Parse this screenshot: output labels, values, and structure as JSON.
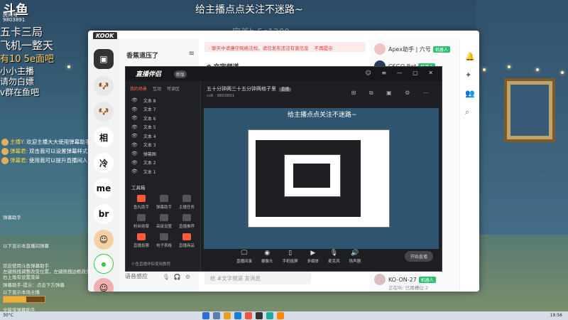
{
  "overlay": {
    "logo": "斗鱼",
    "room_label": "房间号",
    "room_number": "9803891",
    "top_banner": "给主播点点关注不迷路~",
    "sub_banner": "完美b  5e1200",
    "side_lines": [
      "五卡三局",
      "飞机一整天",
      "有10  5e面吧",
      "小小主播",
      "请勿白嫖",
      "v群在鱼吧"
    ],
    "chat": [
      {
        "name": "主播Y:",
        "text": "欢迎主播大大使用弹幕助手"
      },
      {
        "name": "弹幕君:",
        "text": "双击我可以设置弹幕样式"
      },
      {
        "name": "弹幕君:",
        "text": "使用我可以提升直播间人气"
      }
    ],
    "lower_lines": [
      "弹幕助手",
      "以下显示本直播间弹幕",
      "欢迎使用斗鱼弹幕助手",
      "左键拖拽调整改变位置，左键拖拽边框改变大小",
      "右上角有设置菜单",
      "弹幕助手-提示：点击下方弹幕",
      "以下显示本场主播",
      "全能宝弹幕助手"
    ],
    "bar_fraction": 0.55
  },
  "kook": {
    "title": "KOOK",
    "rail_items": [
      "相",
      "冷",
      "me",
      "br"
    ],
    "guild_name": "香蕉道压了",
    "notice": "· 聊天中请遵守网络法规，请勿发布违法有害信息",
    "notice_link": "不再提示",
    "channel_title": "# 文字频道",
    "voice_label": "语音感应",
    "input_placeholder": "给 #文字频道 发消息",
    "members": [
      {
        "name": "Apex助手 | 六号",
        "tag": "机器人",
        "sub": ""
      },
      {
        "name": "CSGO Bot",
        "tag": "机器人",
        "sub": ""
      },
      {
        "name": "KO-ON-27",
        "tag": "机器人",
        "sub": "正在听: 已用槽位:2"
      }
    ]
  },
  "streamer_app": {
    "title": "直播伴侣",
    "version": "新版",
    "side_tabs": [
      "我的场景",
      "互动",
      "可读区"
    ],
    "scene_items": [
      "文本 8",
      "文本 7",
      "文本 6",
      "文本 5",
      "文本 4",
      "文本 3",
      "弹幕图",
      "文本 2",
      "文本 1"
    ],
    "tool_heading": "工具箱",
    "tools": [
      {
        "label": "鱼丸助手",
        "red": true
      },
      {
        "label": "弹幕助手",
        "red": false
      },
      {
        "label": "主播任务",
        "red": false
      },
      {
        "label": "粉丝勋章",
        "red": false
      },
      {
        "label": "高级设置",
        "red": false
      },
      {
        "label": "直播推荐",
        "red": false
      },
      {
        "label": "直播投票",
        "red": true
      },
      {
        "label": "电子表格",
        "red": false
      },
      {
        "label": "直播商品",
        "red": true
      }
    ],
    "side_footer": "小鱼直播伴侣使用教程",
    "room_title": "五十分钟两三十五分钟两格子里",
    "room_pill": "直播",
    "room_meta": "cs6  · 9803891",
    "preview_banner": "给主播点点关注不迷路~",
    "controls": [
      "直播间录",
      "摄像头",
      "手机投屏",
      "多媒体",
      "麦克风",
      "扬声器"
    ],
    "go_button": "开始直播"
  },
  "taskbar": {
    "weather": "30°C",
    "time": "19:56"
  }
}
